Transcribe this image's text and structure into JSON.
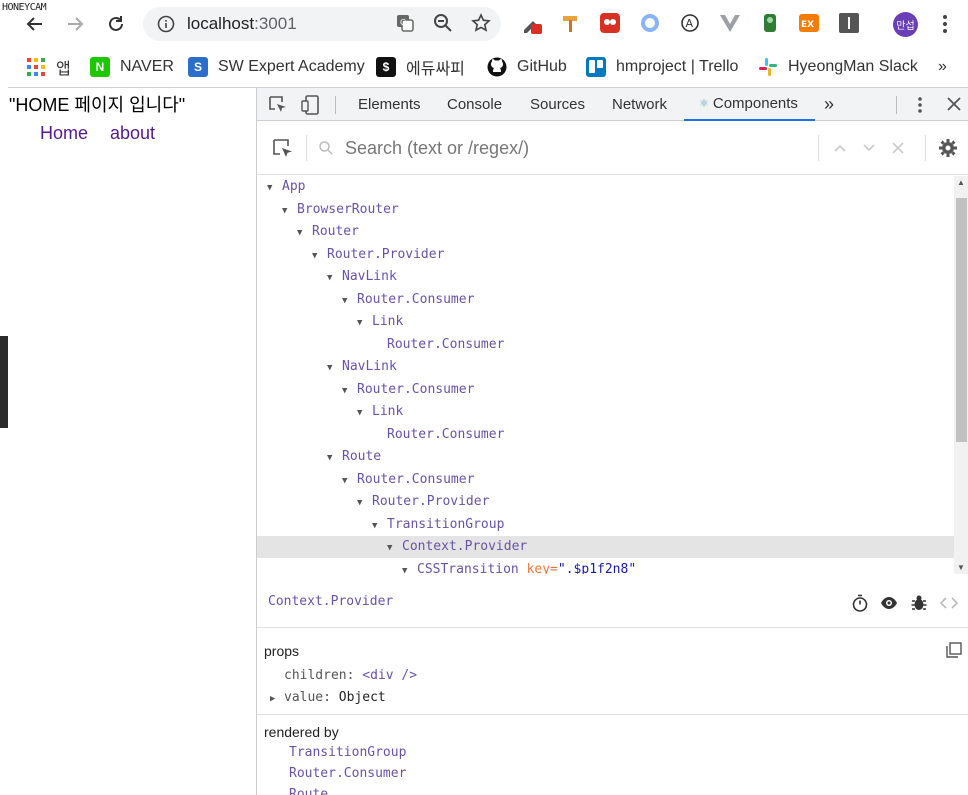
{
  "watermark": "HONEYCAM",
  "browser": {
    "url_host": "localhost",
    "url_port": ":3001",
    "profile_label": "만섭",
    "bookmarks": [
      {
        "label": "앱"
      },
      {
        "label": "NAVER"
      },
      {
        "label": "SW Expert Academy"
      },
      {
        "label": "에듀싸피"
      },
      {
        "label": "GitHub"
      },
      {
        "label": "hmproject | Trello"
      },
      {
        "label": "HyeongMan Slack"
      }
    ],
    "bookmarks_more": "»"
  },
  "page": {
    "title": "\"HOME 페이지 입니다\"",
    "links": [
      "Home",
      "about"
    ]
  },
  "devtools": {
    "tabs": [
      "Elements",
      "Console",
      "Sources",
      "Network",
      "Components"
    ],
    "active_tab": "Components",
    "more_tabs": "»",
    "search_placeholder": "Search (text or /regex/)",
    "tree": [
      {
        "label": "App",
        "depth": 0,
        "expanded": true
      },
      {
        "label": "BrowserRouter",
        "depth": 1,
        "expanded": true
      },
      {
        "label": "Router",
        "depth": 2,
        "expanded": true
      },
      {
        "label": "Router.Provider",
        "depth": 3,
        "expanded": true
      },
      {
        "label": "NavLink",
        "depth": 4,
        "expanded": true
      },
      {
        "label": "Router.Consumer",
        "depth": 5,
        "expanded": true
      },
      {
        "label": "Link",
        "depth": 6,
        "expanded": true
      },
      {
        "label": "Router.Consumer",
        "depth": 7,
        "expanded": false
      },
      {
        "label": "NavLink",
        "depth": 4,
        "expanded": true
      },
      {
        "label": "Router.Consumer",
        "depth": 5,
        "expanded": true
      },
      {
        "label": "Link",
        "depth": 6,
        "expanded": true
      },
      {
        "label": "Router.Consumer",
        "depth": 7,
        "expanded": false
      },
      {
        "label": "Route",
        "depth": 4,
        "expanded": true
      },
      {
        "label": "Router.Consumer",
        "depth": 5,
        "expanded": true
      },
      {
        "label": "Router.Provider",
        "depth": 6,
        "expanded": true
      },
      {
        "label": "TransitionGroup",
        "depth": 7,
        "expanded": true
      },
      {
        "label": "Context.Provider",
        "depth": 8,
        "expanded": true,
        "selected": true
      },
      {
        "label": "CSSTransition",
        "depth": 9,
        "expanded": true,
        "key_name": "key",
        "key_value": "\".$p1f2n8\""
      }
    ],
    "selected_component": "Context.Provider",
    "props_title": "props",
    "props": [
      {
        "key": "children",
        "value": "<div />"
      },
      {
        "key": "value",
        "value": "Object"
      }
    ],
    "rendered_by_title": "rendered by",
    "rendered_by": [
      "TransitionGroup",
      "Router.Consumer",
      "Route"
    ]
  }
}
